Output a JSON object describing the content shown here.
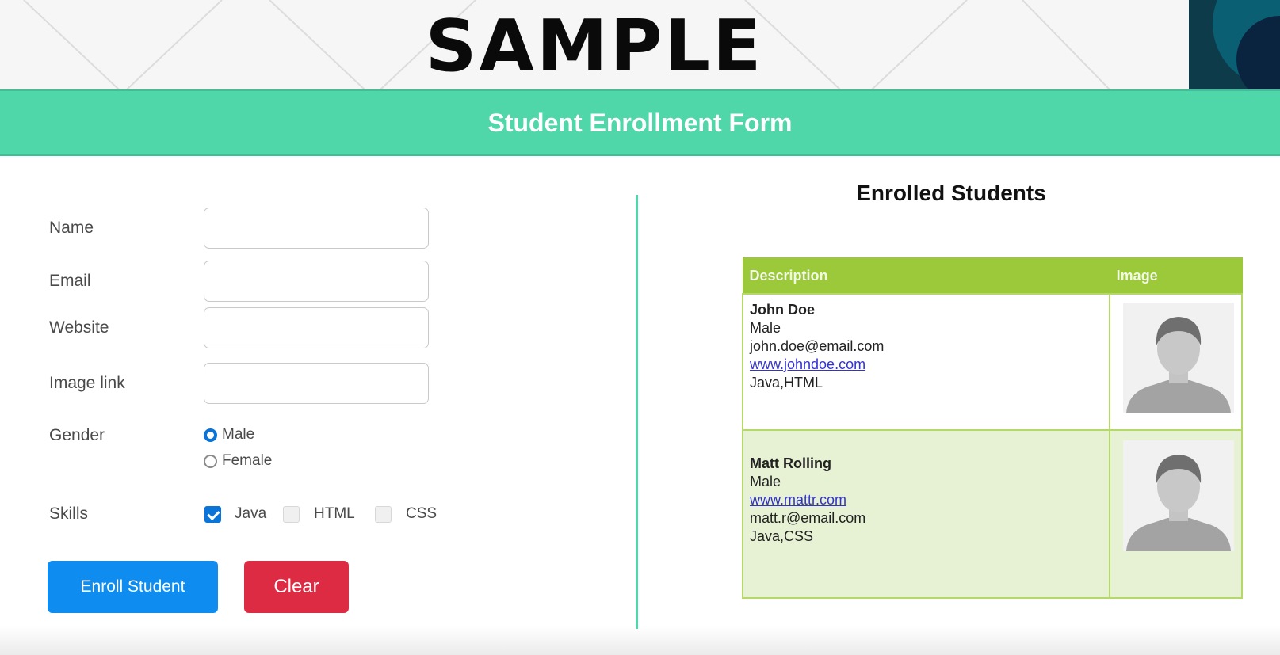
{
  "banner": {
    "title": "SAMPLE"
  },
  "header": {
    "title": "Student Enrollment Form"
  },
  "form": {
    "name_label": "Name",
    "email_label": "Email",
    "website_label": "Website",
    "image_label": "Image link",
    "gender_label": "Gender",
    "gender_options": [
      "Male",
      "Female"
    ],
    "gender_selected": "Male",
    "skills_label": "Skills",
    "skills": [
      {
        "label": "Java",
        "checked": true
      },
      {
        "label": "HTML",
        "checked": false
      },
      {
        "label": "CSS",
        "checked": false
      }
    ],
    "enroll_label": "Enroll Student",
    "clear_label": "Clear"
  },
  "list": {
    "title": "Enrolled Students",
    "columns": [
      "Description",
      "Image"
    ],
    "students": [
      {
        "name": "John Doe",
        "gender": "Male",
        "line3": "john.doe@email.com",
        "line4": "www.johndoe.com",
        "skills": "Java,HTML"
      },
      {
        "name": "Matt Rolling",
        "gender": "Male",
        "line3": "www.mattr.com",
        "line4": "matt.r@email.com",
        "skills": "Java,CSS"
      }
    ]
  },
  "colors": {
    "header_bar": "#4fd6a9",
    "table_header": "#9cc93a",
    "enroll_button": "#0f8cf0",
    "clear_button": "#dc2b43"
  }
}
